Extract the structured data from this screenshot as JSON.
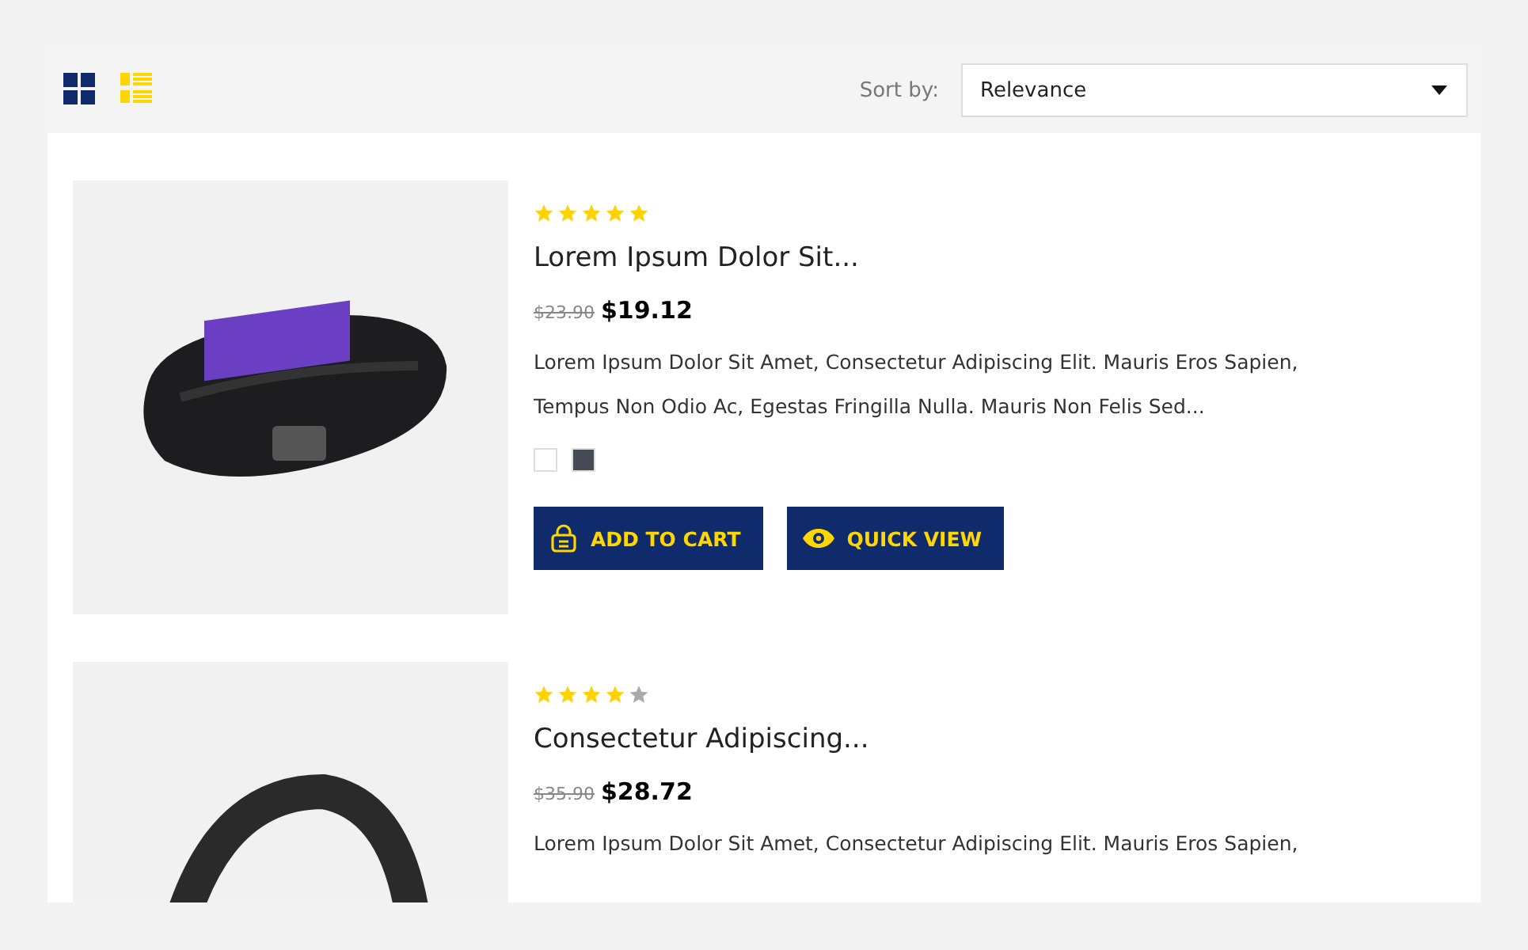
{
  "toolbar": {
    "views": [
      {
        "kind": "grid",
        "selected": false
      },
      {
        "kind": "list",
        "selected": true
      }
    ],
    "sort_label": "Sort by:",
    "sort_value": "Relevance"
  },
  "products": [
    {
      "stars": 5,
      "name": "Lorem Ipsum Dolor Sit...",
      "old_price": "$23.90",
      "price": "$19.12",
      "description": "Lorem Ipsum Dolor Sit Amet, Consectetur Adipiscing Elit. Mauris Eros Sapien, Tempus Non Odio Ac, Egestas Fringilla Nulla. Mauris Non Felis Sed...",
      "swatches": [
        {
          "color": "#ffffff"
        },
        {
          "color": "#454a54"
        }
      ],
      "buttons": [
        {
          "kind": "cart",
          "label": "ADD TO CART"
        },
        {
          "kind": "view",
          "label": "QUICK VIEW"
        }
      ]
    },
    {
      "stars": 4,
      "name": "Consectetur Adipiscing...",
      "old_price": "$35.90",
      "price": "$28.72",
      "description": "Lorem Ipsum Dolor Sit Amet, Consectetur Adipiscing Elit. Mauris Eros Sapien,"
    }
  ]
}
